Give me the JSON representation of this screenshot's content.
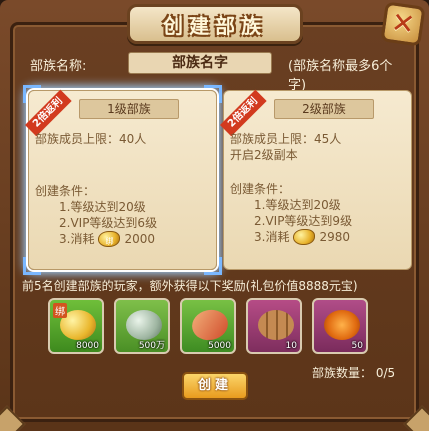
{
  "dialog": {
    "title": "创建部族",
    "close_symbol": "✕"
  },
  "name_row": {
    "label": "部族名称:",
    "value": "部族名字",
    "hint": "(部族名称最多6个字)"
  },
  "cards": [
    {
      "ribbon": "2倍返利",
      "level": "1级部族",
      "member_limit": "部族成员上限：40人",
      "extra": "",
      "conditions_title": "创建条件：",
      "cond1": "1.等级达到20级",
      "cond2": "2.VIP等级达到6级",
      "cond3_label": "3.消耗",
      "cost_icon": "bound-gold-icon",
      "cost_icon_text": "绑",
      "cost_value": "2000",
      "selected": true
    },
    {
      "ribbon": "2倍返利",
      "level": "2级部族",
      "member_limit": "部族成员上限：45人",
      "extra": "开启2级副本",
      "conditions_title": "创建条件：",
      "cond1": "1.等级达到20级",
      "cond2": "2.VIP等级达到9级",
      "cond3_label": "3.消耗",
      "cost_icon": "gold-icon",
      "cost_value": "2980",
      "selected": false
    }
  ],
  "reward_note": "前5名创建部族的玩家，额外获得以下奖励(礼包价值8888元宝)",
  "rewards": [
    {
      "icon": "bound-gold-ingot-icon",
      "tag": "绑",
      "count": "8000"
    },
    {
      "icon": "jade-pot-icon",
      "count": "500万"
    },
    {
      "icon": "token-card-icon",
      "count": "5000"
    },
    {
      "icon": "wood-logs-icon",
      "count": "10"
    },
    {
      "icon": "horned-emblem-icon",
      "count": "50"
    }
  ],
  "tribe_count_label": "部族数量：",
  "tribe_count_value": "0/5",
  "create_button": "创建"
}
